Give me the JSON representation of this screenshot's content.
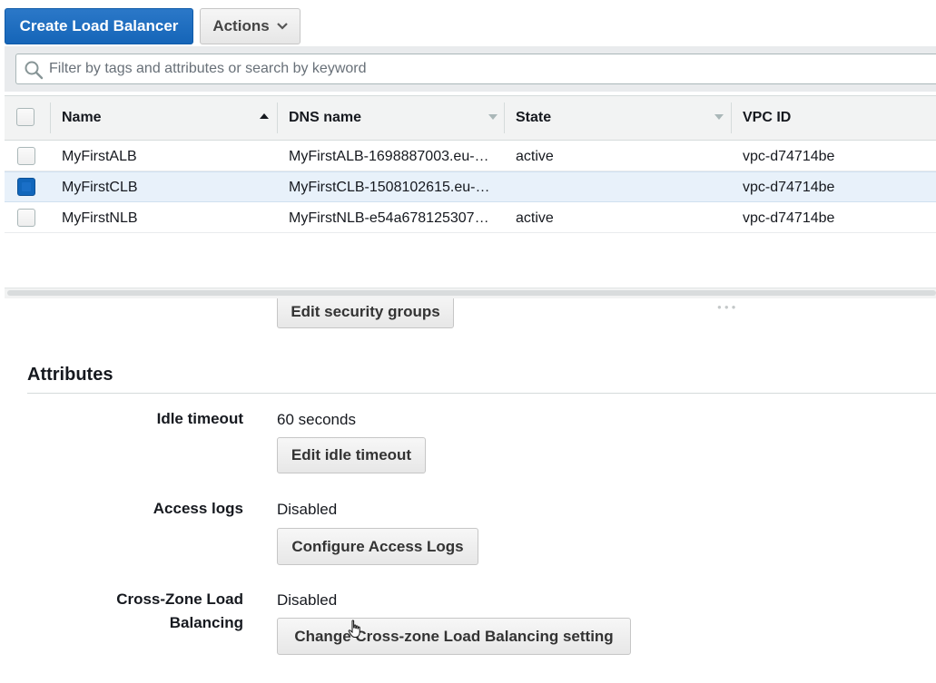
{
  "toolbar": {
    "create_label": "Create Load Balancer",
    "actions_label": "Actions"
  },
  "search": {
    "placeholder": "Filter by tags and attributes or search by keyword"
  },
  "table": {
    "columns": [
      "Name",
      "DNS name",
      "State",
      "VPC ID"
    ],
    "rows": [
      {
        "name": "MyFirstALB",
        "dns": "MyFirstALB-1698887003.eu-…",
        "state": "active",
        "vpc": "vpc-d74714be",
        "selected": false
      },
      {
        "name": "MyFirstCLB",
        "dns": "MyFirstCLB-1508102615.eu-…",
        "state": "",
        "vpc": "vpc-d74714be",
        "selected": true
      },
      {
        "name": "MyFirstNLB",
        "dns": "MyFirstNLB-e54a678125307…",
        "state": "active",
        "vpc": "vpc-d74714be",
        "selected": false
      }
    ]
  },
  "details": {
    "edit_security_groups_label": "Edit security groups",
    "attributes_title": "Attributes",
    "idle_timeout": {
      "label": "Idle timeout",
      "value": "60 seconds",
      "button": "Edit idle timeout"
    },
    "access_logs": {
      "label": "Access logs",
      "value": "Disabled",
      "button": "Configure Access Logs"
    },
    "cross_zone": {
      "label_line1": "Cross-Zone Load",
      "label_line2": "Balancing",
      "value": "Disabled",
      "button": "Change Cross-zone Load Balancing setting"
    }
  },
  "colors": {
    "primary": "#1565b8",
    "selected_row": "#e8f1fa",
    "header_bg": "#f2f3f3"
  }
}
